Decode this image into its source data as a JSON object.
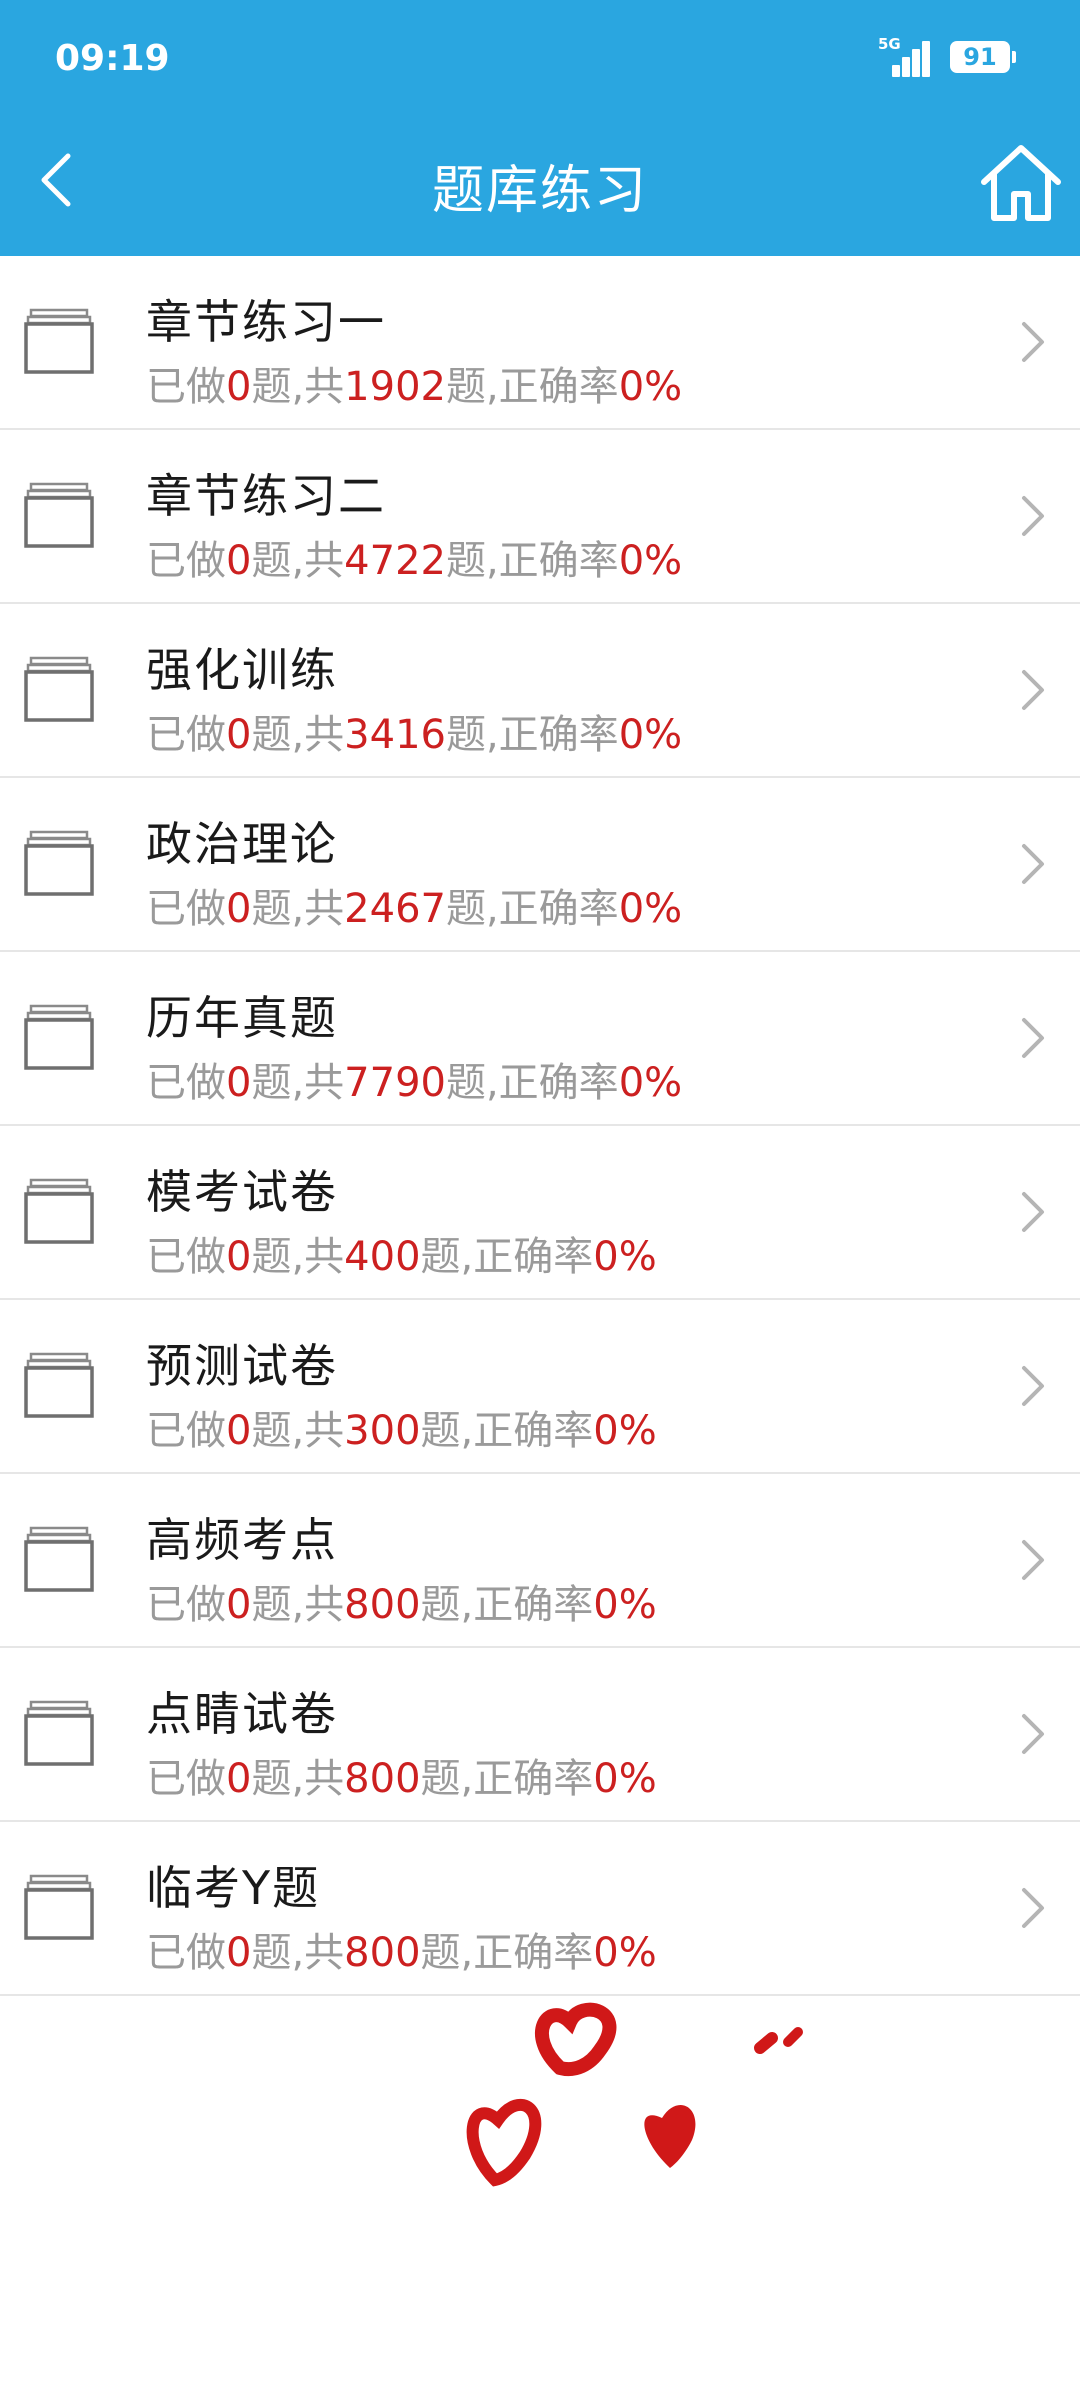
{
  "status_bar": {
    "time": "09:19",
    "network": "5G",
    "battery": "91"
  },
  "header": {
    "title": "题库练习"
  },
  "stats_text": {
    "done_prefix": "已做",
    "unit_mid": "题,共",
    "unit_end": "题,正确率"
  },
  "items": [
    {
      "title": "章节练习一",
      "done": "0",
      "total": "1902",
      "accuracy": "0%"
    },
    {
      "title": "章节练习二",
      "done": "0",
      "total": "4722",
      "accuracy": "0%"
    },
    {
      "title": "强化训练",
      "done": "0",
      "total": "3416",
      "accuracy": "0%"
    },
    {
      "title": "政治理论",
      "done": "0",
      "total": "2467",
      "accuracy": "0%"
    },
    {
      "title": "历年真题",
      "done": "0",
      "total": "7790",
      "accuracy": "0%"
    },
    {
      "title": "模考试卷",
      "done": "0",
      "total": "400",
      "accuracy": "0%"
    },
    {
      "title": "预测试卷",
      "done": "0",
      "total": "300",
      "accuracy": "0%"
    },
    {
      "title": "高频考点",
      "done": "0",
      "total": "800",
      "accuracy": "0%"
    },
    {
      "title": "点睛试卷",
      "done": "0",
      "total": "800",
      "accuracy": "0%"
    },
    {
      "title": "临考Y题",
      "done": "0",
      "total": "800",
      "accuracy": "0%"
    }
  ],
  "icons": {
    "back": "back-chevron-icon",
    "home": "home-icon",
    "folder": "folder-stack-icon",
    "chevron": "chevron-right-icon",
    "decor": "hearts-doodle"
  },
  "colors": {
    "header_bg": "#2aa6e0",
    "accent_red": "#cc2020",
    "muted_text": "#9a9a9a"
  }
}
